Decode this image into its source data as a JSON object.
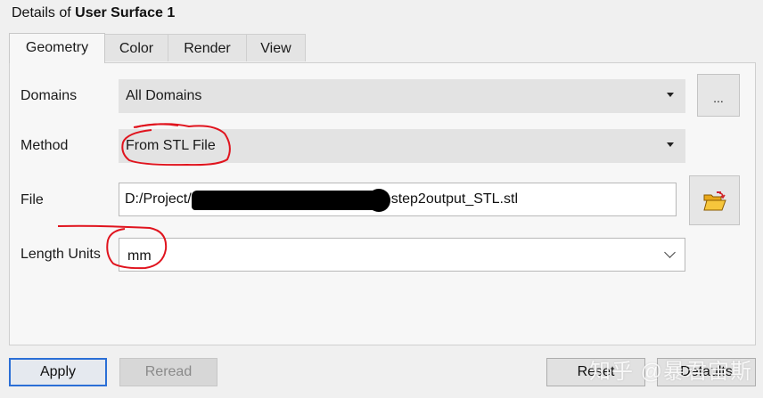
{
  "window": {
    "title_prefix": "Details of",
    "title_name": "User Surface 1"
  },
  "tabs": [
    {
      "label": "Geometry",
      "active": true
    },
    {
      "label": "Color",
      "active": false
    },
    {
      "label": "Render",
      "active": false
    },
    {
      "label": "View",
      "active": false
    }
  ],
  "fields": {
    "domains": {
      "label": "Domains",
      "value": "All Domains",
      "more_button": "..."
    },
    "method": {
      "label": "Method",
      "value": "From STL File"
    },
    "file": {
      "label": "File",
      "value_start": "D:/Project/",
      "value_end": "step2output_STL.stl",
      "browse_icon": "folder-open-icon"
    },
    "length_units": {
      "label": "Length Units",
      "value": "mm"
    }
  },
  "buttons": {
    "apply": "Apply",
    "reread": "Reread",
    "reset": "Reset",
    "defaults": "Defaults"
  },
  "watermark": "知乎 @暴君宙斯",
  "colors": {
    "annotation": "#e0141e",
    "focus_border": "#2b6fd6"
  }
}
